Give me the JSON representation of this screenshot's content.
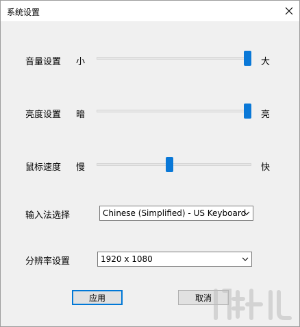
{
  "window": {
    "title": "系统设置"
  },
  "volume": {
    "label": "音量设置",
    "min_label": "小",
    "max_label": "大",
    "level": 1.0
  },
  "brightness": {
    "label": "亮度设置",
    "min_label": "暗",
    "max_label": "亮",
    "level": 1.0
  },
  "mouse_speed": {
    "label": "鼠标速度",
    "min_label": "慢",
    "max_label": "快",
    "level": 0.47
  },
  "input_method": {
    "label": "输入法选择",
    "value": "Chinese (Simplified) - US Keyboard"
  },
  "resolution": {
    "label": "分辨率设置",
    "value": "1920 x 1080"
  },
  "buttons": {
    "apply": "应用",
    "cancel": "取消"
  },
  "colors": {
    "accent": "#0a78d7",
    "window_bg": "#f0f0f0",
    "titlebar_bg": "#ffffff"
  },
  "icons": {
    "close": "close-icon",
    "dropdown": "chevron-down-icon"
  }
}
